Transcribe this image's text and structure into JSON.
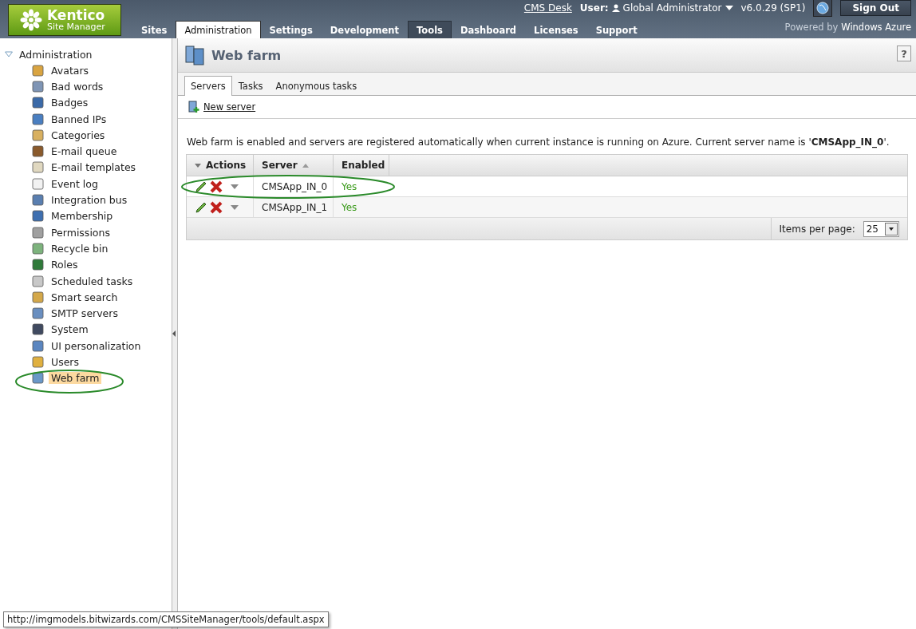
{
  "header": {
    "logo": {
      "brand": "Kentico",
      "product": "Site Manager"
    },
    "nav_tabs": [
      {
        "label": "Sites",
        "selected": false,
        "highlighted": false
      },
      {
        "label": "Administration",
        "selected": true,
        "highlighted": false
      },
      {
        "label": "Settings",
        "selected": false,
        "highlighted": false
      },
      {
        "label": "Development",
        "selected": false,
        "highlighted": false
      },
      {
        "label": "Tools",
        "selected": false,
        "highlighted": true
      },
      {
        "label": "Dashboard",
        "selected": false,
        "highlighted": false
      },
      {
        "label": "Licenses",
        "selected": false,
        "highlighted": false
      },
      {
        "label": "Support",
        "selected": false,
        "highlighted": false
      }
    ],
    "cms_desk_link": "CMS Desk",
    "user_label": "User:",
    "user_name": "Global Administrator",
    "version": "v6.0.29 (SP1)",
    "sign_out": "Sign Out",
    "powered_by": "Powered by",
    "powered_brand": "Windows Azure"
  },
  "sidebar": {
    "root": {
      "label": "Administration",
      "expanded": true,
      "children": [
        {
          "label": "Avatars",
          "selected": false
        },
        {
          "label": "Bad words",
          "selected": false
        },
        {
          "label": "Badges",
          "selected": false
        },
        {
          "label": "Banned IPs",
          "selected": false
        },
        {
          "label": "Categories",
          "selected": false
        },
        {
          "label": "E-mail queue",
          "selected": false
        },
        {
          "label": "E-mail templates",
          "selected": false
        },
        {
          "label": "Event log",
          "selected": false
        },
        {
          "label": "Integration bus",
          "selected": false
        },
        {
          "label": "Membership",
          "selected": false
        },
        {
          "label": "Permissions",
          "selected": false
        },
        {
          "label": "Recycle bin",
          "selected": false
        },
        {
          "label": "Roles",
          "selected": false
        },
        {
          "label": "Scheduled tasks",
          "selected": false
        },
        {
          "label": "Smart search",
          "selected": false
        },
        {
          "label": "SMTP servers",
          "selected": false
        },
        {
          "label": "System",
          "selected": false
        },
        {
          "label": "UI personalization",
          "selected": false
        },
        {
          "label": "Users",
          "selected": false
        },
        {
          "label": "Web farm",
          "selected": true
        }
      ]
    }
  },
  "main": {
    "title": "Web farm",
    "help": "?",
    "tabs": [
      {
        "label": "Servers",
        "selected": true
      },
      {
        "label": "Tasks",
        "selected": false
      },
      {
        "label": "Anonymous tasks",
        "selected": false
      }
    ],
    "new_server": "New server",
    "info": "Web farm is enabled and servers are registered automatically when current instance is running on Azure. Current server name is '**CMSApp_IN_0**'.",
    "grid": {
      "columns": [
        "Actions",
        "Server",
        "Enabled"
      ],
      "rows": [
        {
          "server": "CMSApp_IN_0",
          "enabled": "Yes"
        },
        {
          "server": "CMSApp_IN_1",
          "enabled": "Yes"
        }
      ],
      "items_per_page_label": "Items per page:",
      "items_per_page": "25"
    }
  },
  "tooltip": "http://imgmodels.bitwizards.com/CMSSiteManager/tools/default.aspx"
}
